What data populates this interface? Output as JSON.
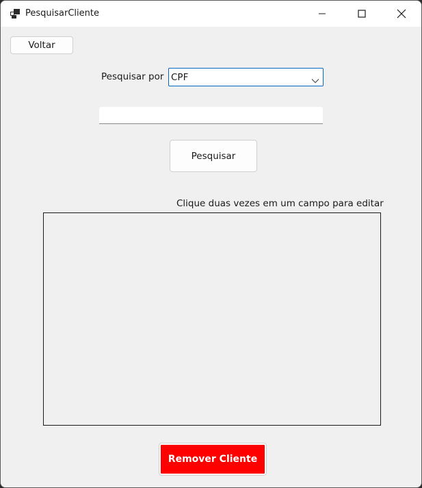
{
  "window": {
    "title": "PesquisarCliente"
  },
  "icons": {
    "app": "app-window-icon",
    "minimize": "minimize-icon",
    "maximize": "maximize-icon",
    "close": "close-icon",
    "dropdown": "chevron-down-icon"
  },
  "toolbar": {
    "back_label": "Voltar"
  },
  "search": {
    "by_label": "Pesquisar por",
    "by_selected": "CPF",
    "query_value": "",
    "submit_label": "Pesquisar"
  },
  "results": {
    "hint": "Clique duas vezes em um campo para editar"
  },
  "actions": {
    "remove_label": "Remover Cliente",
    "remove_color": "#ff0000"
  },
  "colors": {
    "accent": "#0067c0",
    "background": "#f0f0f0"
  }
}
